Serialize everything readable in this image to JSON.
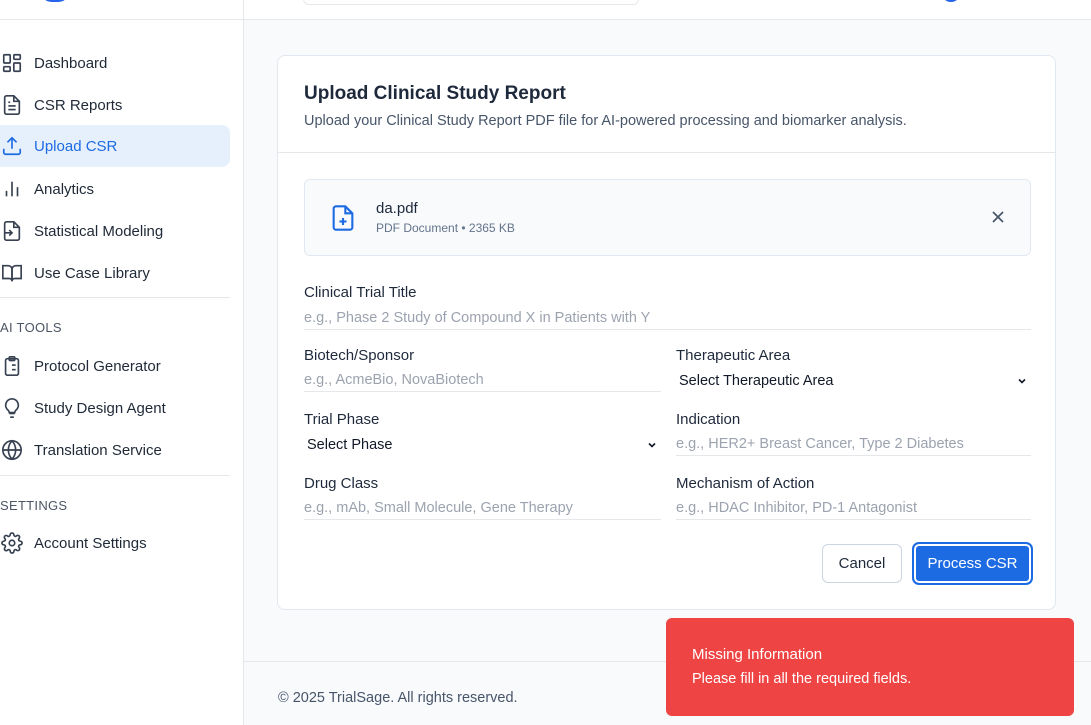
{
  "sidebar": {
    "items": [
      {
        "label": "Dashboard",
        "icon": "dashboard-grid-icon"
      },
      {
        "label": "CSR Reports",
        "icon": "document-icon"
      },
      {
        "label": "Upload CSR",
        "icon": "upload-icon",
        "active": true
      },
      {
        "label": "Analytics",
        "icon": "bar-chart-icon"
      },
      {
        "label": "Statistical Modeling",
        "icon": "file-export-icon"
      },
      {
        "label": "Use Case Library",
        "icon": "book-open-icon"
      }
    ],
    "ai_tools_title": "AI TOOLS",
    "ai_tools": [
      {
        "label": "Protocol Generator",
        "icon": "clipboard-list-icon"
      },
      {
        "label": "Study Design Agent",
        "icon": "lightbulb-icon"
      },
      {
        "label": "Translation Service",
        "icon": "globe-icon"
      }
    ],
    "settings_title": "SETTINGS",
    "settings": [
      {
        "label": "Account Settings",
        "icon": "gear-icon"
      }
    ]
  },
  "upload": {
    "title": "Upload Clinical Study Report",
    "subtitle": "Upload your Clinical Study Report PDF file for AI-powered processing and biomarker analysis.",
    "file": {
      "name": "da.pdf",
      "meta": "PDF Document • 2365 KB"
    }
  },
  "form": {
    "trial_title": {
      "label": "Clinical Trial Title",
      "placeholder": "e.g., Phase 2 Study of Compound X in Patients with Y"
    },
    "sponsor": {
      "label": "Biotech/Sponsor",
      "placeholder": "e.g., AcmeBio, NovaBiotech"
    },
    "therapeutic_area": {
      "label": "Therapeutic Area",
      "value": "Select Therapeutic Area"
    },
    "trial_phase": {
      "label": "Trial Phase",
      "value": "Select Phase"
    },
    "indication": {
      "label": "Indication",
      "placeholder": "e.g., HER2+ Breast Cancer, Type 2 Diabetes"
    },
    "drug_class": {
      "label": "Drug Class",
      "placeholder": "e.g., mAb, Small Molecule, Gene Therapy"
    },
    "mechanism": {
      "label": "Mechanism of Action",
      "placeholder": "e.g., HDAC Inhibitor, PD-1 Antagonist"
    },
    "cancel_label": "Cancel",
    "process_label": "Process CSR"
  },
  "footer": {
    "text": "© 2025 TrialSage. All rights reserved."
  },
  "toast": {
    "title": "Missing Information",
    "message": "Please fill in all the required fields."
  },
  "colors": {
    "accent": "#1d6be3",
    "active_bg": "#e6f0fd",
    "toast_bg": "#ef4444"
  }
}
